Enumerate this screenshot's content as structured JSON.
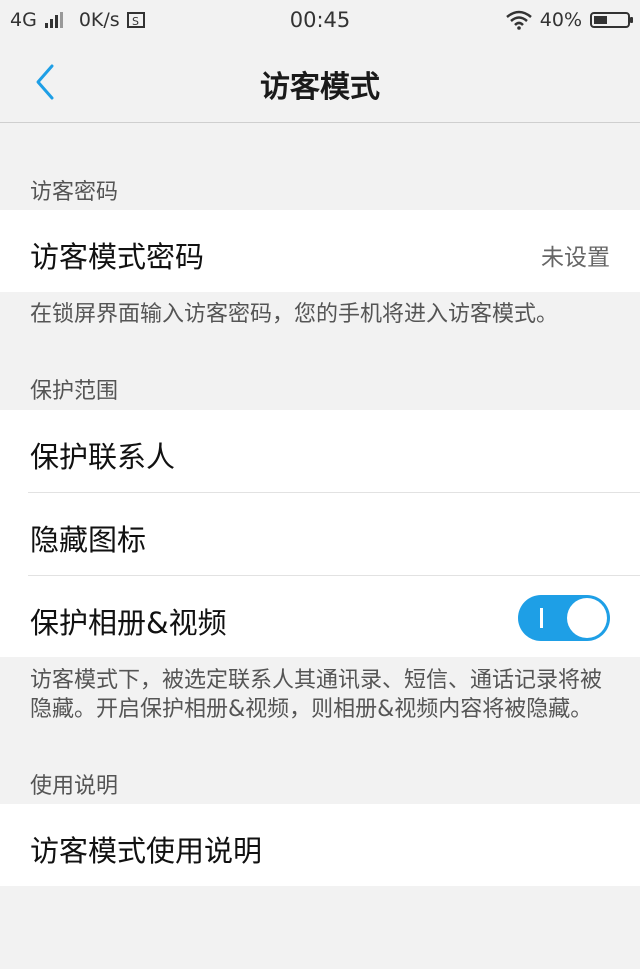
{
  "status_bar": {
    "network": "4G",
    "speed": "0K/s",
    "time": "00:45",
    "battery": "40%"
  },
  "header": {
    "title": "访客模式",
    "back_icon": "chevron-left-icon"
  },
  "sections": {
    "password": {
      "label": "访客密码",
      "row_label": "访客模式密码",
      "row_value": "未设置",
      "description": "在锁屏界面输入访客密码，您的手机将进入访客模式。"
    },
    "protection": {
      "label": "保护范围",
      "items": [
        {
          "label": "保护联系人"
        },
        {
          "label": "隐藏图标"
        },
        {
          "label": "保护相册&视频",
          "toggle_on": true
        }
      ],
      "description": "访客模式下，被选定联系人其通讯录、短信、通话记录将被隐藏。开启保护相册&视频，则相册&视频内容将被隐藏。"
    },
    "help": {
      "label": "使用说明",
      "row_label": "访客模式使用说明"
    }
  },
  "colors": {
    "accent": "#1e9fe6",
    "background": "#f2f2f2",
    "card": "#ffffff"
  }
}
